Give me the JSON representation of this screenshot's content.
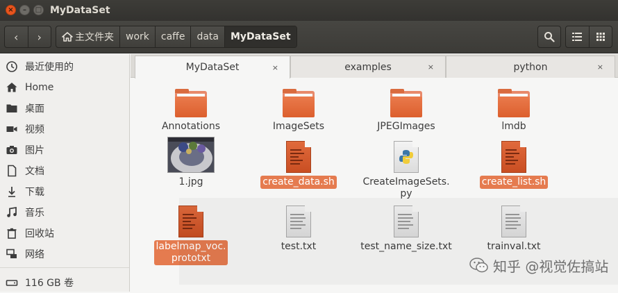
{
  "window": {
    "title": "MyDataSet",
    "close_glyph": "×",
    "min_glyph": "–",
    "max_glyph": "□"
  },
  "toolbar": {
    "back_glyph": "‹",
    "forward_glyph": "›",
    "breadcrumbs": [
      "主文件夹",
      "work",
      "caffe",
      "data",
      "MyDataSet"
    ]
  },
  "sidebar": {
    "items": [
      {
        "label": "最近使用的",
        "icon": "clock-icon"
      },
      {
        "label": "Home",
        "icon": "home-icon"
      },
      {
        "label": "桌面",
        "icon": "folder-icon"
      },
      {
        "label": "视频",
        "icon": "video-icon"
      },
      {
        "label": "图片",
        "icon": "camera-icon"
      },
      {
        "label": "文档",
        "icon": "document-icon"
      },
      {
        "label": "下载",
        "icon": "download-icon"
      },
      {
        "label": "音乐",
        "icon": "music-icon"
      },
      {
        "label": "回收站",
        "icon": "trash-icon"
      },
      {
        "label": "网络",
        "icon": "network-icon"
      },
      {
        "label": "116 GB 卷",
        "icon": "drive-icon"
      }
    ]
  },
  "tabs": [
    {
      "label": "MyDataSet",
      "close": "×",
      "active": true
    },
    {
      "label": "examples",
      "close": "×",
      "active": false
    },
    {
      "label": "python",
      "close": "×",
      "active": false
    }
  ],
  "files": [
    {
      "name": "Annotations",
      "kind": "folder",
      "selected": false
    },
    {
      "name": "ImageSets",
      "kind": "folder",
      "selected": false
    },
    {
      "name": "JPEGImages",
      "kind": "folder",
      "selected": false
    },
    {
      "name": "lmdb",
      "kind": "folder",
      "selected": false
    },
    {
      "name": "1.jpg",
      "kind": "image",
      "selected": false
    },
    {
      "name": "create_data.sh",
      "kind": "script",
      "selected": true
    },
    {
      "name": "CreateImageSets.\npy",
      "kind": "python",
      "selected": false
    },
    {
      "name": "create_list.sh",
      "kind": "script",
      "selected": true
    },
    {
      "name": "labelmap_voc.\nprototxt",
      "kind": "script",
      "selected": true
    },
    {
      "name": "test.txt",
      "kind": "text",
      "selected": false
    },
    {
      "name": "test_name_size.txt",
      "kind": "text",
      "selected": false
    },
    {
      "name": "trainval.txt",
      "kind": "text",
      "selected": false
    }
  ],
  "watermark": {
    "text": "知乎 @视觉佐搞站"
  },
  "colors": {
    "accent": "#e57b4f",
    "titlebar": "#3d3c38",
    "folder": "#e0683a"
  }
}
